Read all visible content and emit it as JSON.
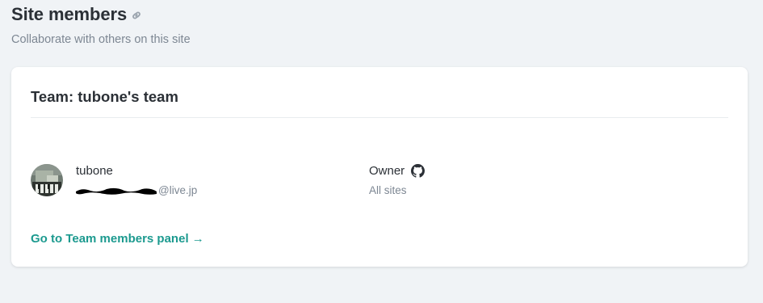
{
  "header": {
    "title": "Site members",
    "subtitle": "Collaborate with others on this site",
    "link_icon": "link-icon"
  },
  "team": {
    "title": "Team: tubone's team",
    "members": [
      {
        "name": "tubone",
        "email_visible": "@live.jp",
        "email_redacted": true,
        "avatar": "avatar-photo",
        "role": "Owner",
        "role_icon": "github-icon",
        "access": "All sites"
      }
    ],
    "panel_link": "Go to Team members panel →"
  },
  "colors": {
    "background": "#f0f3f6",
    "card": "#ffffff",
    "accent": "#1c9a8f",
    "text": "#2b3036",
    "muted": "#7d8793"
  }
}
